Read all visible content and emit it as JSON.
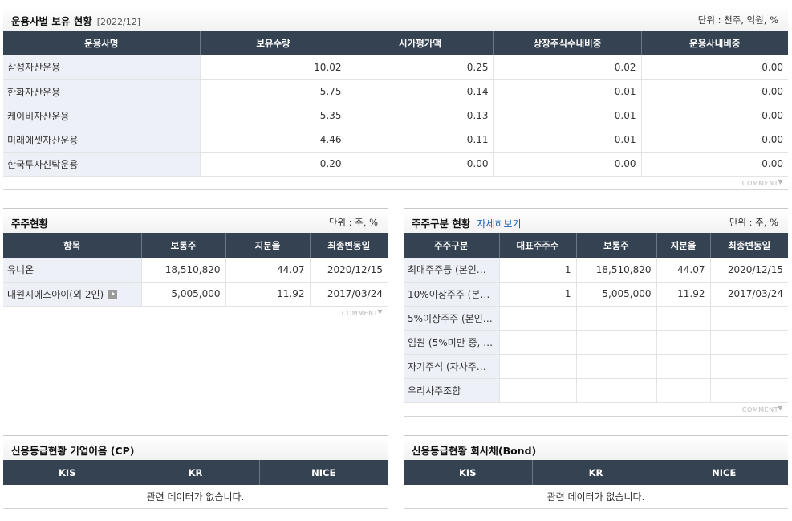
{
  "managers": {
    "title": "운용사별 보유 현황",
    "date": "[2022/12]",
    "unit": "단위 : 천주, 억원, %",
    "columns": [
      "운용사명",
      "보유수량",
      "시가평가액",
      "상장주식수내비중",
      "운용사내비중"
    ],
    "rows": [
      [
        "삼성자산운용",
        "10.02",
        "0.25",
        "0.02",
        "0.00"
      ],
      [
        "한화자산운용",
        "5.75",
        "0.14",
        "0.01",
        "0.00"
      ],
      [
        "케이비자산운용",
        "5.35",
        "0.13",
        "0.01",
        "0.00"
      ],
      [
        "미래에셋자산운용",
        "4.46",
        "0.11",
        "0.01",
        "0.00"
      ],
      [
        "한국투자신탁운용",
        "0.20",
        "0.00",
        "0.00",
        "0.00"
      ]
    ],
    "comment": "COMMENT"
  },
  "shareholders": {
    "title": "주주현황",
    "unit": "단위 : 주, %",
    "columns": [
      "항목",
      "보통주",
      "지분율",
      "최종변동일"
    ],
    "rows": [
      [
        "유니온",
        "18,510,820",
        "44.07",
        "2020/12/15"
      ],
      [
        "대원지에스아이(외 2인)",
        "5,005,000",
        "11.92",
        "2017/03/24"
      ]
    ],
    "comment": "COMMENT"
  },
  "holder_types": {
    "title": "주주구분 현황",
    "detail_link": "자세히보기",
    "unit": "단위 : 주, %",
    "columns": [
      "주주구분",
      "대표주주수",
      "보통주",
      "지분율",
      "최종변동일"
    ],
    "rows": [
      [
        "최대주주등 (본인…",
        "1",
        "18,510,820",
        "44.07",
        "2020/12/15"
      ],
      [
        "10%이상주주 (본…",
        "1",
        "5,005,000",
        "11.92",
        "2017/03/24"
      ],
      [
        "5%이상주주 (본인…",
        "",
        "",
        "",
        ""
      ],
      [
        "임원 (5%미만 중, …",
        "",
        "",
        "",
        ""
      ],
      [
        "자기주식 (자사주…",
        "",
        "",
        "",
        ""
      ],
      [
        "우리사주조합",
        "",
        "",
        "",
        ""
      ]
    ],
    "comment": "COMMENT"
  },
  "credit_cp": {
    "title": "신용등급현황 기업어음 (CP)",
    "columns": [
      "KIS",
      "KR",
      "NICE"
    ],
    "empty": "관련 데이터가 없습니다."
  },
  "credit_bond": {
    "title": "신용등급현황 회사채(Bond)",
    "columns": [
      "KIS",
      "KR",
      "NICE"
    ],
    "empty": "관련 데이터가 없습니다."
  }
}
